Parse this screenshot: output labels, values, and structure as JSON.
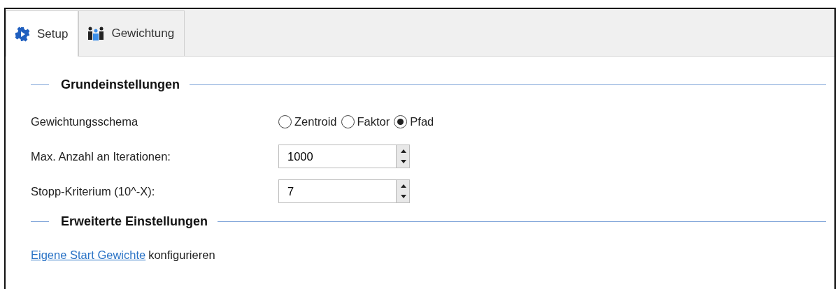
{
  "tabs": [
    {
      "label": "Setup",
      "selected": true
    },
    {
      "label": "Gewichtung",
      "selected": false
    }
  ],
  "sections": [
    {
      "title": "Grundeinstellungen",
      "rows": [
        {
          "kind": "radio",
          "label": "Gewichtungsschema",
          "options": [
            {
              "label": "Zentroid",
              "selected": false
            },
            {
              "label": "Faktor",
              "selected": false
            },
            {
              "label": "Pfad",
              "selected": true
            }
          ]
        },
        {
          "kind": "spin",
          "label": "Max. Anzahl an Iterationen:",
          "value": "1000"
        },
        {
          "kind": "spin",
          "label": "Stopp-Kriterium (10^-X):",
          "value": "7"
        }
      ]
    },
    {
      "title": "Erweiterte Einstellungen",
      "rows": [
        {
          "kind": "link",
          "link": "Eigene Start Gewichte",
          "text": "konfigurieren"
        }
      ]
    }
  ]
}
